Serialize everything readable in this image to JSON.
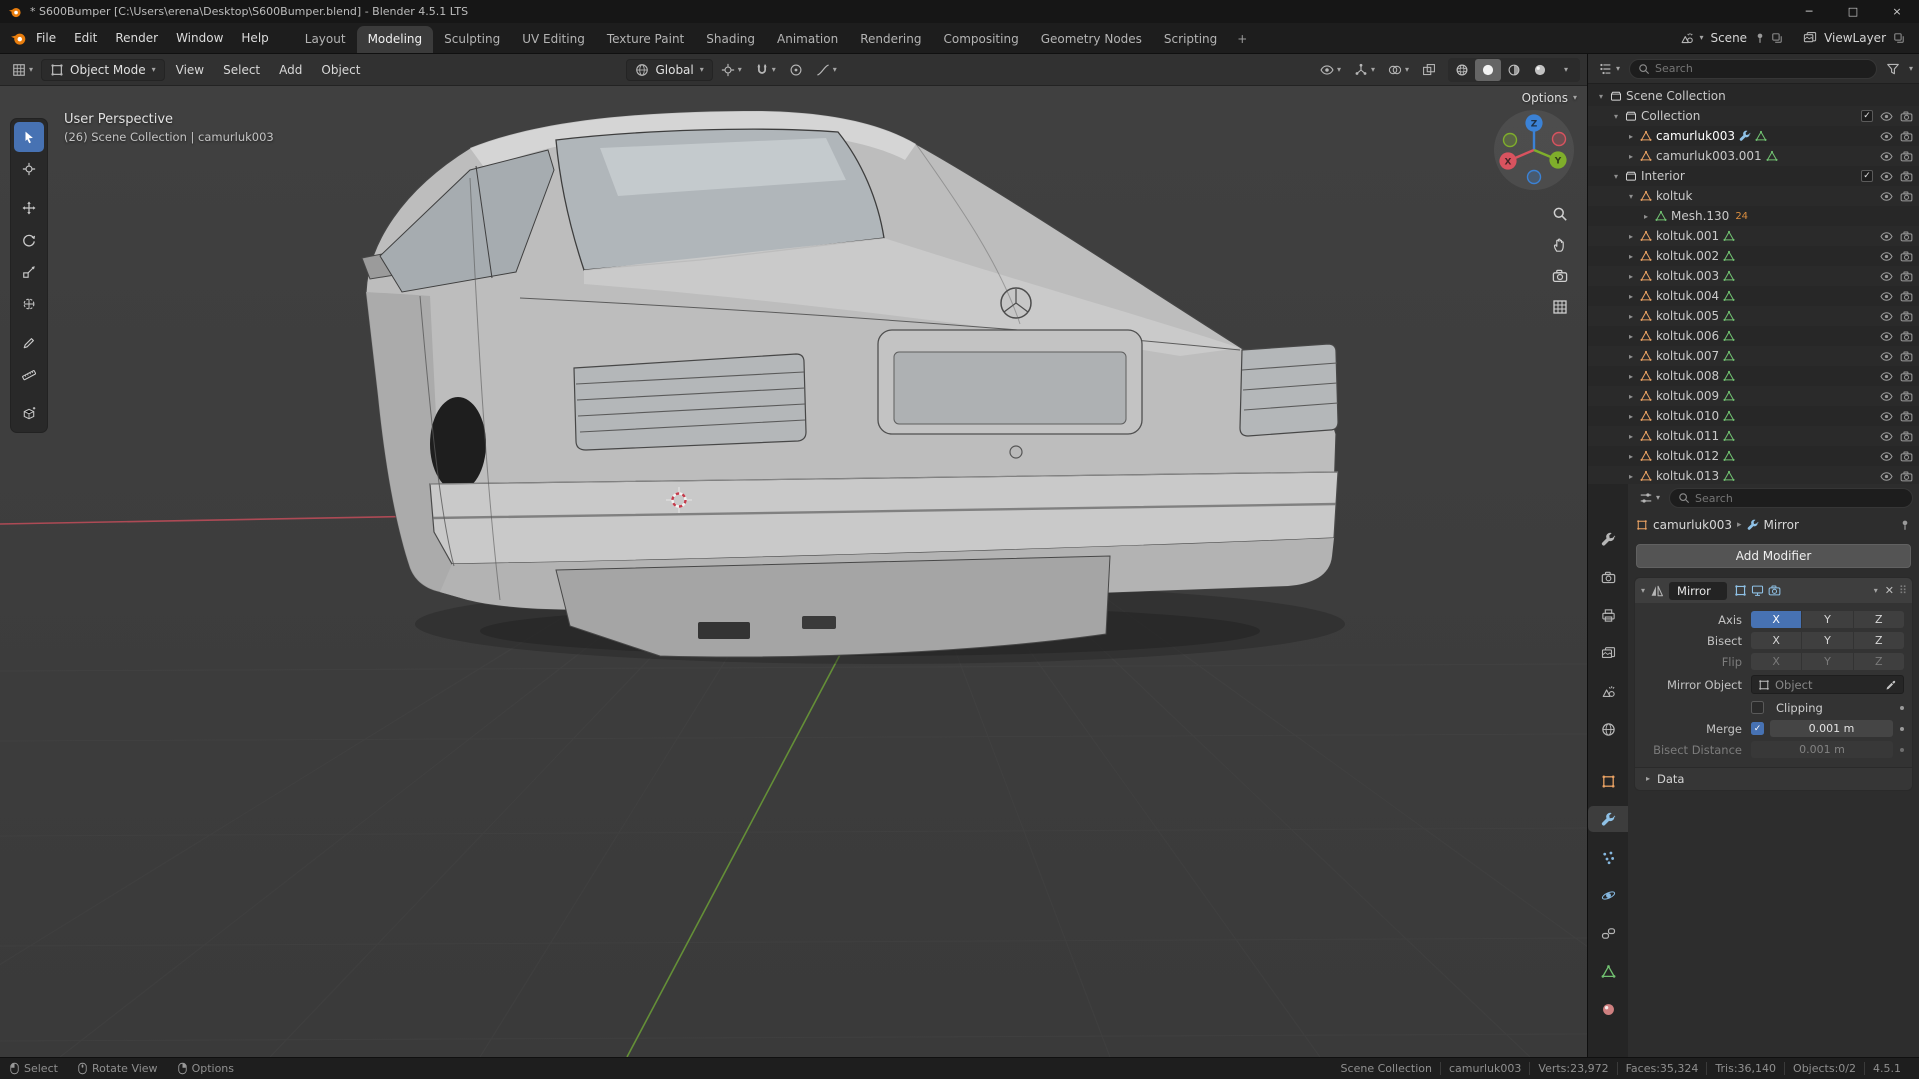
{
  "colors": {
    "accent": "#4772b3",
    "object_orange": "#e8a163",
    "data_green": "#71c171",
    "axis_x": "#d9535f",
    "axis_y": "#7fae2b",
    "axis_z": "#3b82d6",
    "logo_orange": "#e87d0d"
  },
  "titlebar": {
    "title": "* S600Bumper [C:\\Users\\erena\\Desktop\\S600Bumper.blend] - Blender 4.5.1 LTS",
    "controls": [
      "─",
      "□",
      "×"
    ]
  },
  "menubar": {
    "menus": [
      "File",
      "Edit",
      "Render",
      "Window",
      "Help"
    ],
    "workspaces": [
      {
        "label": "Layout"
      },
      {
        "label": "Modeling",
        "active": true
      },
      {
        "label": "Sculpting"
      },
      {
        "label": "UV Editing"
      },
      {
        "label": "Texture Paint"
      },
      {
        "label": "Shading"
      },
      {
        "label": "Animation"
      },
      {
        "label": "Rendering"
      },
      {
        "label": "Compositing"
      },
      {
        "label": "Geometry Nodes"
      },
      {
        "label": "Scripting"
      }
    ],
    "add_tab": "+",
    "scene_label": "Scene",
    "viewlayer_label": "ViewLayer"
  },
  "tool_header": {
    "mode": "Object Mode",
    "menus": [
      "View",
      "Select",
      "Add",
      "Object"
    ],
    "orientation": "Global"
  },
  "viewport": {
    "overlay_title": "User Perspective",
    "overlay_context": "(26) Scene Collection | camurluk003",
    "options_label": "Options",
    "axes": [
      "X",
      "Y",
      "Z"
    ]
  },
  "outliner": {
    "search_placeholder": "Search",
    "rows": [
      {
        "label": "Scene Collection"
      },
      {
        "label": "Collection"
      },
      {
        "label": "camurluk003"
      },
      {
        "label": "camurluk003.001"
      },
      {
        "label": "Interior"
      },
      {
        "label": "koltuk"
      },
      {
        "label": "Mesh.130",
        "badge": "24"
      },
      {
        "label": "koltuk.001"
      },
      {
        "label": "koltuk.002"
      },
      {
        "label": "koltuk.003"
      },
      {
        "label": "koltuk.004"
      },
      {
        "label": "koltuk.005"
      },
      {
        "label": "koltuk.006"
      },
      {
        "label": "koltuk.007"
      },
      {
        "label": "koltuk.008"
      },
      {
        "label": "koltuk.009"
      },
      {
        "label": "koltuk.010"
      },
      {
        "label": "koltuk.011"
      },
      {
        "label": "koltuk.012"
      },
      {
        "label": "koltuk.013"
      }
    ]
  },
  "properties": {
    "search_placeholder": "Search",
    "breadcrumb": {
      "object": "camurluk003",
      "modifier": "Mirror"
    },
    "add_modifier": "Add Modifier",
    "modifier": {
      "name": "Mirror",
      "axis_label": "Axis",
      "bisect_label": "Bisect",
      "flip_label": "Flip",
      "axes": [
        "X",
        "Y",
        "Z"
      ],
      "active_axis": "X",
      "mirror_object_label": "Mirror Object",
      "mirror_object_placeholder": "Object",
      "clipping_label": "Clipping",
      "merge_label": "Merge",
      "merge_value": "0.001 m",
      "bisect_distance_label": "Bisect Distance",
      "bisect_distance_value": "0.001 m",
      "data_label": "Data"
    }
  },
  "statusbar": {
    "hints": [
      "Select",
      "Rotate View",
      "Options"
    ],
    "stats": [
      "Scene Collection",
      "camurluk003",
      "Verts:23,972",
      "Faces:35,324",
      "Tris:36,140",
      "Objects:0/2",
      "4.5.1"
    ]
  }
}
